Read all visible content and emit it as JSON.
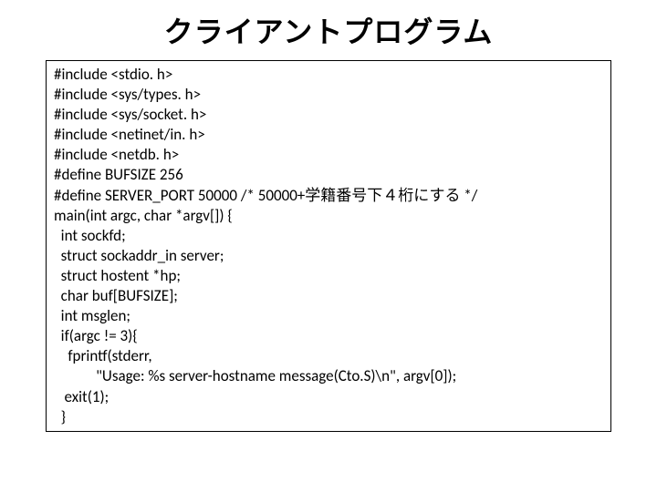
{
  "title": "クライアントプログラム",
  "code": {
    "l0": "#include <stdio. h>",
    "l1": "#include <sys/types. h>",
    "l2": "#include <sys/socket. h>",
    "l3": "#include <netinet/in. h>",
    "l4": "#include <netdb. h>",
    "l5": "#define BUFSIZE 256",
    "l6": "#define SERVER_PORT 50000 /* 50000+学籍番号下４桁にする */",
    "l7": "main(int argc, char *argv[]) {",
    "l8": "  int sockfd;",
    "l9": "  struct sockaddr_in server;",
    "l10": "  struct hostent *hp;",
    "l11": "  char buf[BUFSIZE];",
    "l12": "  int msglen;",
    "l13": "  if(argc != 3){",
    "l14": "    fprintf(stderr,",
    "l15": "            \"Usage: %s server-hostname message(Cto.S)\\n\", argv[0]);",
    "l16": "   exit(1);",
    "l17": "  }"
  }
}
